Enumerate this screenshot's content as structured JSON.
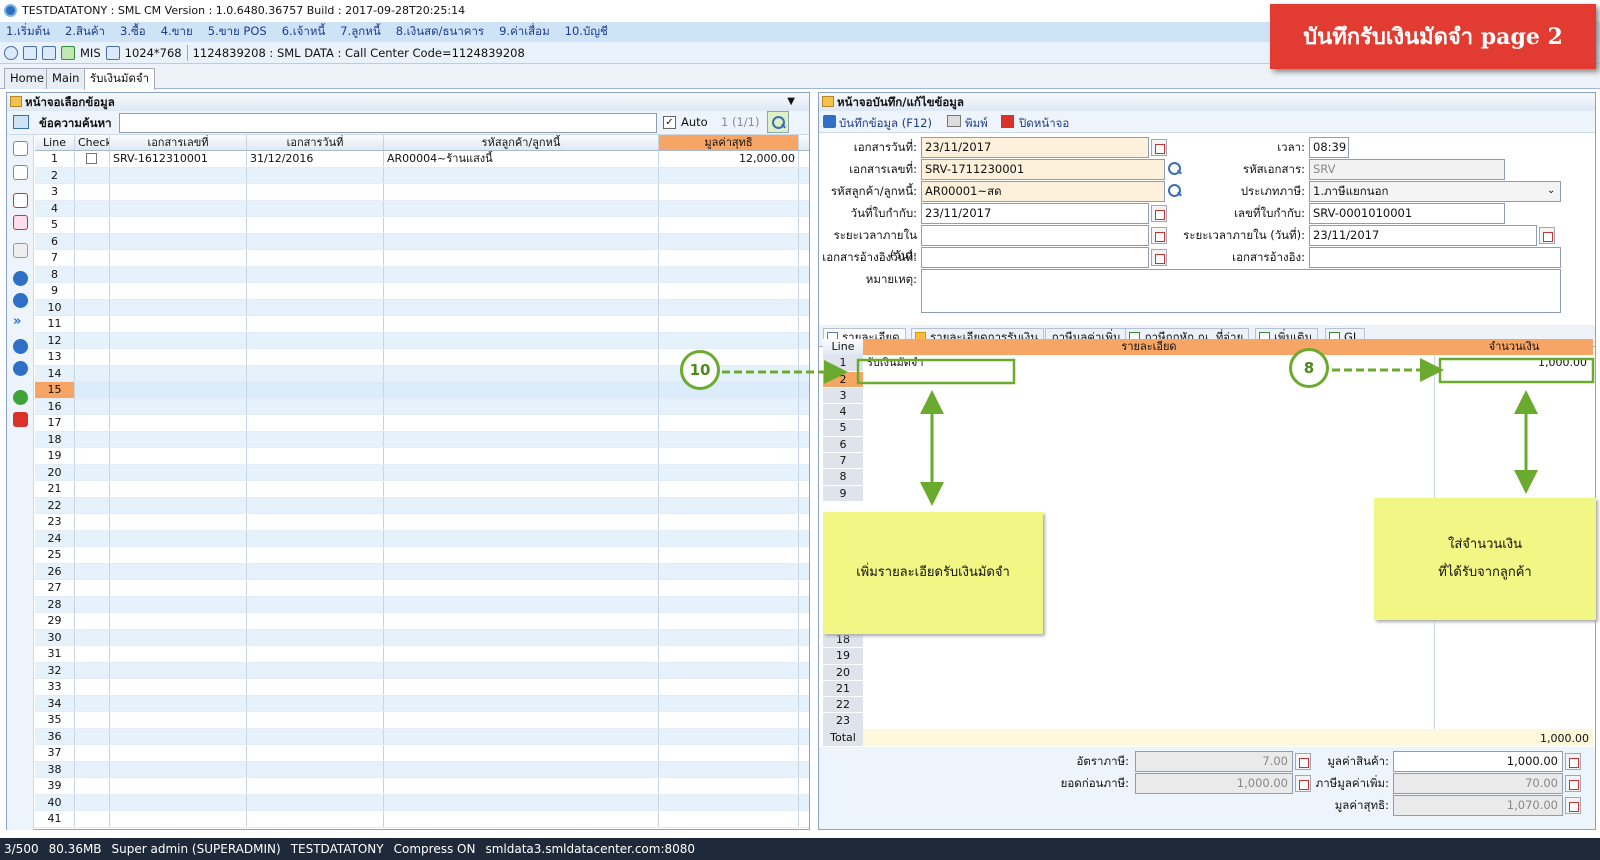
{
  "window": {
    "title": "TESTDATATONY : SML CM Version : 1.0.6480.36757  Build : 2017-09-28T20:25:14"
  },
  "menu": [
    "1.เริ่มต้น",
    "2.สินค้า",
    "3.ซื้อ",
    "4.ขาย",
    "5.ขาย POS",
    "6.เจ้าหนี้",
    "7.ลูกหนี้",
    "8.เงินสด/ธนาคาร",
    "9.ค่าเสื่อม",
    "10.บัญชี"
  ],
  "toolbar": {
    "mis": "MIS",
    "resolution": "1024*768",
    "info": "1124839208 : SML DATA : Call Center Code=1124839208"
  },
  "tabs": [
    "Home",
    "Main",
    "รับเงินมัดจำ"
  ],
  "banner": "บันทึกรับเงินมัดจำ page 2",
  "left": {
    "title": "หน้าจอเลือกข้อมูล",
    "search_label": "ข้อความค้นหา",
    "auto_label": "Auto",
    "page_info": "1 (1/1)",
    "columns": [
      "Line",
      "Check",
      "เอกสารเลขที่",
      "เอกสารวันที่",
      "รหัสลูกค้า/ลูกหนี้",
      "มูลค่าสุทธิ"
    ],
    "first_row": {
      "line": "1",
      "doc_no": "SRV-1612310001",
      "doc_date": "31/12/2016",
      "customer": "AR00004~ร้านแสงนี้",
      "amount": "12,000.00"
    },
    "line_numbers": [
      "1",
      "2",
      "3",
      "4",
      "5",
      "6",
      "7",
      "8",
      "9",
      "10",
      "11",
      "12",
      "13",
      "14",
      "15",
      "16",
      "17",
      "18",
      "19",
      "20",
      "21",
      "22",
      "23",
      "24",
      "25",
      "26",
      "27",
      "28",
      "29",
      "30",
      "31",
      "32",
      "33",
      "34",
      "35",
      "36",
      "37",
      "38",
      "39",
      "40",
      "41"
    ]
  },
  "right": {
    "title": "หน้าจอบันทึก/แก้ไขข้อมูล",
    "save_label": "บันทึกข้อมูล (F12)",
    "print_label": "พิมพ์",
    "close_label": "ปิดหน้าจอ",
    "fields": {
      "doc_date_label": "เอกสารวันที่:",
      "doc_date": "23/11/2017",
      "time_label": "เวลา:",
      "time": "08:39",
      "doc_no_label": "เอกสารเลขที่:",
      "doc_no": "SRV-1711230001",
      "doc_code_label": "รหัสเอกสาร:",
      "doc_code": "SRV",
      "customer_label": "รหัสลูกค้า/ลูกหนี้:",
      "customer": "AR00001~สด",
      "tax_type_label": "ประเภทภาษี:",
      "tax_type": "1.ภาษีแยกนอก",
      "tax_inv_date_label": "วันที่ใบกำกับ:",
      "tax_inv_date": "23/11/2017",
      "tax_inv_no_label": "เลขที่ใบกำกับ:",
      "tax_inv_no": "SRV-0001010001",
      "period_days_label": "ระยะเวลาภายใน (วัน):",
      "period_days": "",
      "period_date_label": "ระยะเวลาภายใน (วันที่):",
      "period_date": "23/11/2017",
      "ref_date_label": "เอกสารอ้างอิงวันที่:",
      "ref_date": "",
      "ref_doc_label": "เอกสารอ้างอิง:",
      "ref_doc": "",
      "remark_label": "หมายเหตุ:"
    },
    "detail_tabs": [
      "รายละเอียด",
      "รายละเอียดการรับเงิน",
      "ภาษีมูลค่าเพิ่ม",
      "ภาษีถูกหัก ณ. ที่จ่าย",
      "เพิ่มเติม",
      "GL"
    ],
    "detail_columns": [
      "Line",
      "รายละเอียด",
      "จำนวนเงิน"
    ],
    "detail_row1": {
      "desc": "รับเงินมัดจำ",
      "amount": "1,000.00"
    },
    "detail_lines": [
      "1",
      "2",
      "3",
      "4",
      "5",
      "6",
      "7",
      "8",
      "9",
      "18",
      "19",
      "20",
      "21",
      "22",
      "23"
    ],
    "total_label": "Total",
    "total_value": "1,000.00",
    "summary": {
      "tax_rate_label": "อัตราภาษี:",
      "tax_rate": "7.00",
      "before_tax_label": "ยอดก่อนภาษี:",
      "before_tax": "1,000.00",
      "goods_value_label": "มูลค่าสินค้า:",
      "goods_value": "1,000.00",
      "vat_label": "ภาษีมูลค่าเพิ่ม:",
      "vat": "70.00",
      "net_label": "มูลค่าสุทธิ:",
      "net": "1,070.00"
    }
  },
  "annotations": {
    "circle_10": "10",
    "circle_8": "8",
    "note_left": "เพิ่มรายละเอียดรับเงินมัดจำ",
    "note_right_1": "ใส่จำนวนเงิน",
    "note_right_2": "ที่ได้รับจากลูกค้า"
  },
  "status": {
    "count": "3/500",
    "memory": "80.36MB",
    "user": "Super admin (SUPERADMIN)",
    "db": "TESTDATATONY",
    "compress": "Compress ON",
    "server": "smldata3.smldatacenter.com:8080"
  }
}
